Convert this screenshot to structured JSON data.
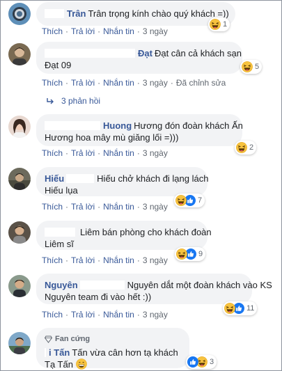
{
  "actions": {
    "like": "Thích",
    "reply": "Trả lời",
    "message": "Nhắn tin",
    "time": "3 ngày",
    "edited": "Đã chỉnh sửa"
  },
  "replies_label": "3 phản hồi",
  "fan_badge": "Fan cứng",
  "comments": [
    {
      "name": "Trân",
      "text1": "Trân trọng kính chào quý khách =))",
      "text2": "",
      "reaction_count": "1",
      "reactions": [
        "haha-icon"
      ],
      "edited": false
    },
    {
      "name": "Đạt",
      "text1": "Đạt cân cả khách sạn",
      "text2": "Đạt 09",
      "reaction_count": "5",
      "reactions": [
        "haha-icon"
      ],
      "edited": true
    },
    {
      "name": "Huong",
      "text1": "Hương đón đoàn khách Ấn",
      "text2": "Hương hoa mây mù giăng lối =)))",
      "reaction_count": "2",
      "reactions": [
        "haha-icon"
      ],
      "edited": false
    },
    {
      "name": "Hiếu",
      "text1": "Hiếu chở khách đi lạng lách",
      "text2": "Hiếu lụa",
      "reaction_count": "7",
      "reactions": [
        "haha-icon",
        "like-icon"
      ],
      "edited": false
    },
    {
      "name": "",
      "text1": "Liêm bán phòng cho khách đoàn",
      "text2": "Liêm sĩ",
      "reaction_count": "9",
      "reactions": [
        "haha-icon",
        "like-icon"
      ],
      "edited": false
    },
    {
      "name": "Nguyên",
      "text1": "Nguyên dắt một đoàn khách vào KS",
      "text2": "Nguyên team đi vào hết :))",
      "reaction_count": "11",
      "reactions": [
        "haha-icon",
        "like-icon"
      ],
      "edited": false
    },
    {
      "name": "i Tấn",
      "text1": "Tấn vừa cân hơn tạ khách",
      "text2": "Tạ Tấn",
      "reaction_count": "3",
      "reactions": [
        "like-icon",
        "haha-icon"
      ],
      "edited": false
    }
  ]
}
